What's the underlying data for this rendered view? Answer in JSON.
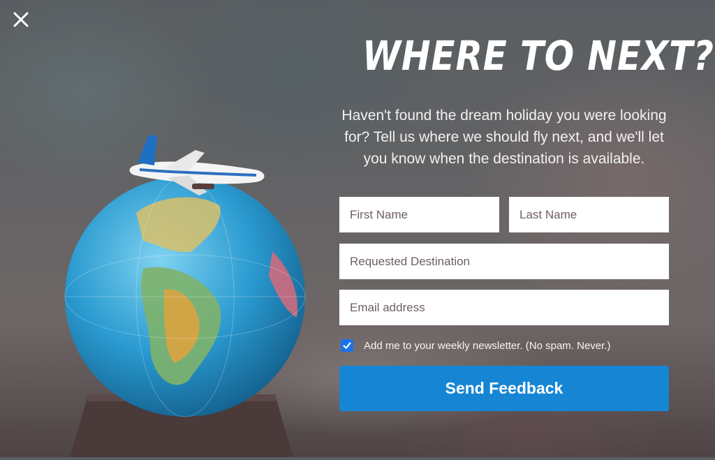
{
  "modal": {
    "close_icon": "close-icon",
    "image_description_icon": "globe-with-airplane-illustration",
    "headline": "WHERE TO NEXT?",
    "intro": "Haven't found the dream holiday you were looking for? Tell us where we should fly next, and we'll let you know when the destination is available."
  },
  "form": {
    "first_name_placeholder": "First Name",
    "last_name_placeholder": "Last Name",
    "destination_placeholder": "Requested Destination",
    "email_placeholder": "Email address",
    "newsletter_label": "Add me to your weekly newsletter. (No spam. Never.)",
    "newsletter_checked": true,
    "submit_label": "Send Feedback"
  },
  "colors": {
    "accent": "#1686d4",
    "checkbox": "#1a73e8",
    "text_on_dark": "#ffffff"
  }
}
